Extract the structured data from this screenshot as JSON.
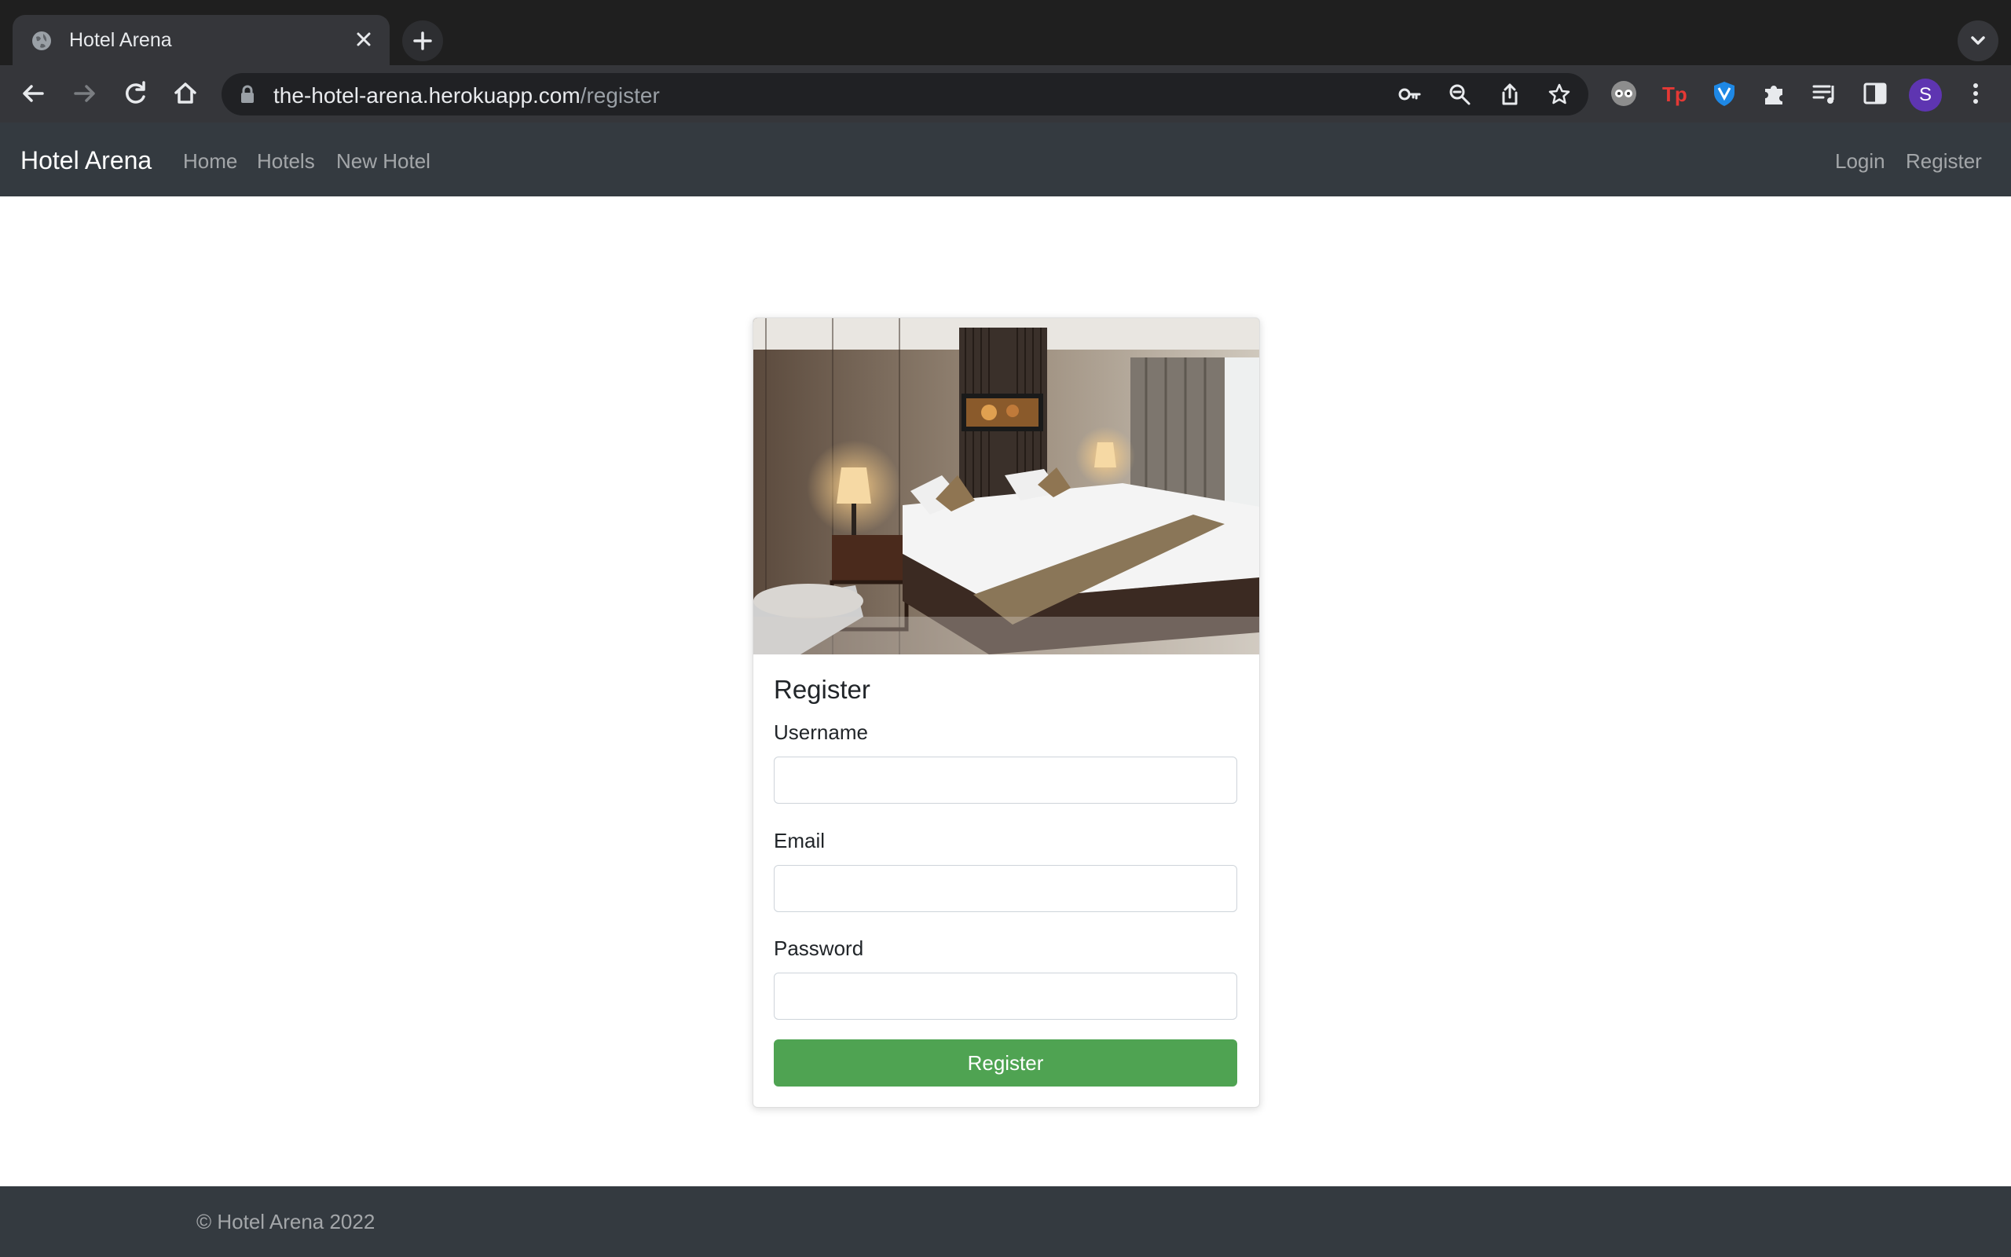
{
  "browser": {
    "tab_title": "Hotel Arena",
    "url_host": "the-hotel-arena.herokuapp.com",
    "url_path": "/register",
    "profile_initial": "S"
  },
  "site": {
    "brand": "Hotel Arena",
    "nav_left": [
      "Home",
      "Hotels",
      "New Hotel"
    ],
    "nav_right": [
      "Login",
      "Register"
    ]
  },
  "form": {
    "title": "Register",
    "username_label": "Username",
    "username_value": "",
    "email_label": "Email",
    "email_value": "",
    "password_label": "Password",
    "password_value": "",
    "submit_label": "Register"
  },
  "footer": {
    "text": "© Hotel Arena 2022"
  },
  "colors": {
    "navbar": "#343a40",
    "submit": "#4fa352",
    "browser_dark": "#1f1f1f"
  }
}
